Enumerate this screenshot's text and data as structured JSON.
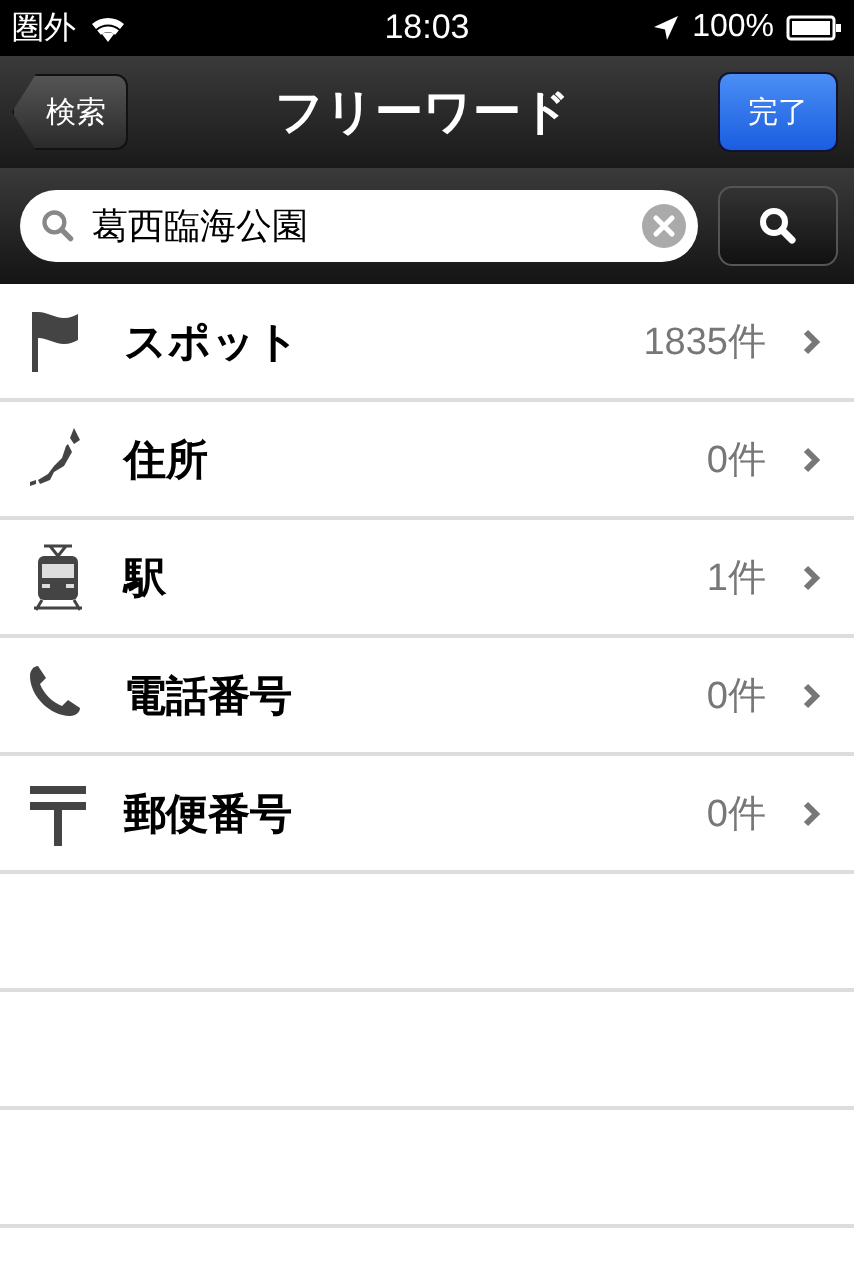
{
  "status_bar": {
    "carrier": "圏外",
    "time": "18:03",
    "battery": "100%"
  },
  "nav_bar": {
    "back": "検索",
    "title": "フリーワード",
    "done": "完了"
  },
  "search": {
    "value": "葛西臨海公園"
  },
  "results": [
    {
      "kind": "flag",
      "label": "スポット",
      "count": "1835件"
    },
    {
      "kind": "map",
      "label": "住所",
      "count": "0件"
    },
    {
      "kind": "train",
      "label": "駅",
      "count": "1件"
    },
    {
      "kind": "phone",
      "label": "電話番号",
      "count": "0件"
    },
    {
      "kind": "postal",
      "label": "郵便番号",
      "count": "0件"
    }
  ]
}
